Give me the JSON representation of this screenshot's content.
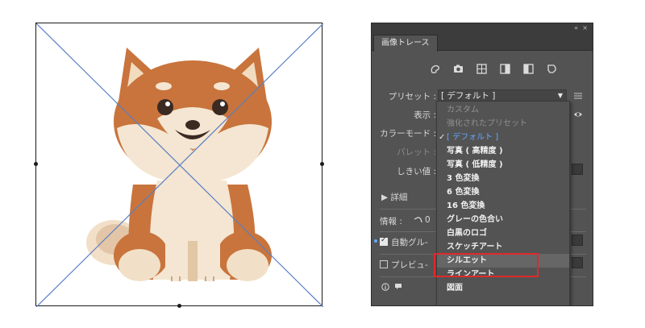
{
  "panel": {
    "tab_label": "画像トレース",
    "collapse_icon": "«",
    "close_icon": "×",
    "preset_icons": [
      "auto-color-icon",
      "high-color-icon",
      "low-color-icon",
      "grayscale-icon",
      "black-white-icon",
      "outline-icon"
    ]
  },
  "fields": {
    "preset_label": "プリセット :",
    "preset_value": "[ デフォルト ]",
    "view_label": "表示 :",
    "color_mode_label": "カラーモード :",
    "palette_label": "パレット :",
    "threshold_label": "しきい値 :",
    "details_label": "▶ 詳細",
    "info_label": "情報 :",
    "info_value": "0",
    "auto_group_label": "自動グル-",
    "preview_label": "プレビュ-"
  },
  "preset_options": [
    {
      "label": "カスタム",
      "state": "disabled"
    },
    {
      "label": "強化されたプリセット",
      "state": "disabled"
    },
    {
      "label": "[ デフォルト ]",
      "state": "current"
    },
    {
      "label": "写真 ( 高精度 )",
      "state": "normal"
    },
    {
      "label": "写真 ( 低精度 )",
      "state": "normal"
    },
    {
      "label": "3 色変換",
      "state": "normal"
    },
    {
      "label": "6 色変換",
      "state": "normal"
    },
    {
      "label": "16 色変換",
      "state": "normal"
    },
    {
      "label": "グレーの色合い",
      "state": "normal"
    },
    {
      "label": "白黒のロゴ",
      "state": "normal"
    },
    {
      "label": "スケッチアート",
      "state": "normal"
    },
    {
      "label": "シルエット",
      "state": "hover"
    },
    {
      "label": "ラインアート",
      "state": "normal"
    },
    {
      "label": "図面",
      "state": "normal"
    }
  ],
  "colors": {
    "panel_bg": "#535353",
    "highlight_border": "#e0292b",
    "current_item": "#63a8ff",
    "cross_lines": "#5b7fc4"
  }
}
